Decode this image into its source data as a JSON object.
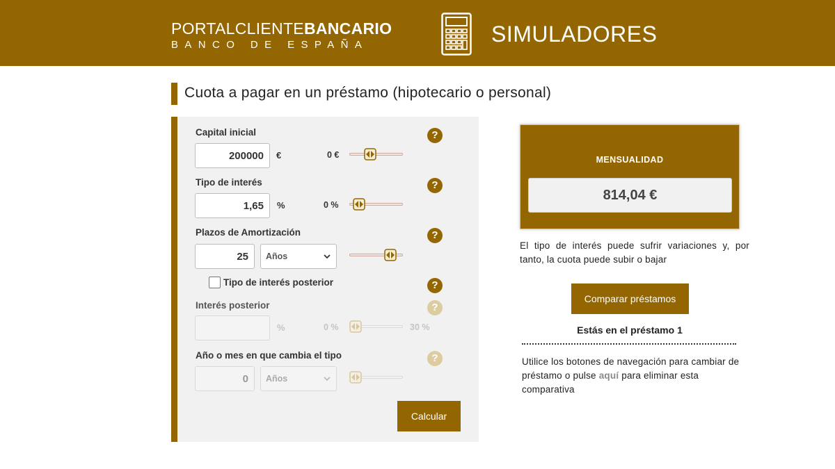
{
  "header": {
    "brand_light": "PORTALCLIENTE",
    "brand_bold": "BANCARIO",
    "brand_sub": "BANCO DE ESPAÑA",
    "section_title": "SIMULADORES",
    "icon": "calculator-icon"
  },
  "page": {
    "title": "Cuota a pagar en un préstamo (hipotecario o personal)"
  },
  "form": {
    "capital": {
      "label": "Capital inicial",
      "value": "200000",
      "unit": "€",
      "min_label": "0 €",
      "slider_fraction": 0.35
    },
    "interest": {
      "label": "Tipo de interés",
      "value": "1,65",
      "unit": "%",
      "min_label": "0 %",
      "slider_fraction": 0.08
    },
    "term": {
      "label": "Plazos de Amortización",
      "value": "25",
      "period_option": "Años",
      "slider_fraction": 0.85
    },
    "later_rate_toggle": {
      "label": "Tipo de interés posterior",
      "checked": false
    },
    "later_rate": {
      "label": "Interés posterior",
      "value": "",
      "unit": "%",
      "min_label": "0 %",
      "max_label": "30 %",
      "slider_fraction": 0.0
    },
    "change_period": {
      "label": "Año o mes en que cambia el tipo",
      "value": "0",
      "period_option": "Años",
      "slider_fraction": 0.0
    },
    "help_icon_text": "?",
    "calculate_label": "Calcular"
  },
  "result": {
    "label": "MENSUALIDAD",
    "value": "814,04 €",
    "note": "El tipo de interés puede sufrir variaciones y, por tanto, la cuota puede subir o bajar",
    "compare_label": "Comparar préstamos",
    "loan_indicator": "Estás en el préstamo 1",
    "nav_before": "Utilice los botones de navegación para cambiar de préstamo o pulse ",
    "nav_link": "aquí",
    "nav_after": " para eliminar esta comparativa"
  },
  "colors": {
    "brand": "#936601",
    "panel_bg": "#f1f1f1",
    "help_disabled": "#dccc9f"
  }
}
